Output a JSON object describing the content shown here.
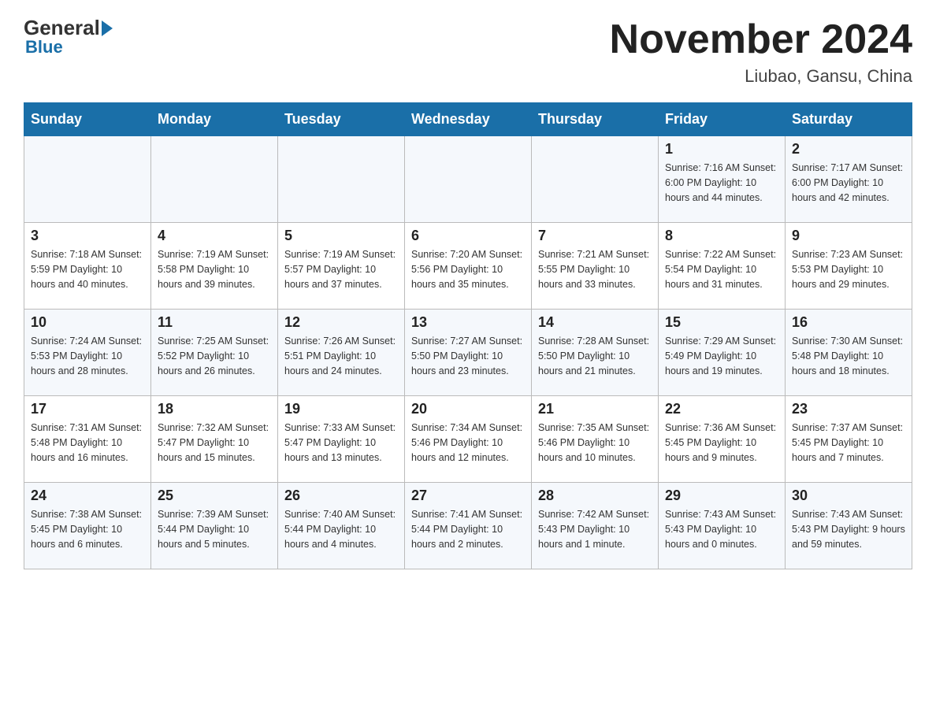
{
  "header": {
    "logo_general": "General",
    "logo_blue": "Blue",
    "month_title": "November 2024",
    "location": "Liubao, Gansu, China"
  },
  "days_of_week": [
    "Sunday",
    "Monday",
    "Tuesday",
    "Wednesday",
    "Thursday",
    "Friday",
    "Saturday"
  ],
  "weeks": [
    [
      {
        "day": "",
        "info": ""
      },
      {
        "day": "",
        "info": ""
      },
      {
        "day": "",
        "info": ""
      },
      {
        "day": "",
        "info": ""
      },
      {
        "day": "",
        "info": ""
      },
      {
        "day": "1",
        "info": "Sunrise: 7:16 AM\nSunset: 6:00 PM\nDaylight: 10 hours and 44 minutes."
      },
      {
        "day": "2",
        "info": "Sunrise: 7:17 AM\nSunset: 6:00 PM\nDaylight: 10 hours and 42 minutes."
      }
    ],
    [
      {
        "day": "3",
        "info": "Sunrise: 7:18 AM\nSunset: 5:59 PM\nDaylight: 10 hours and 40 minutes."
      },
      {
        "day": "4",
        "info": "Sunrise: 7:19 AM\nSunset: 5:58 PM\nDaylight: 10 hours and 39 minutes."
      },
      {
        "day": "5",
        "info": "Sunrise: 7:19 AM\nSunset: 5:57 PM\nDaylight: 10 hours and 37 minutes."
      },
      {
        "day": "6",
        "info": "Sunrise: 7:20 AM\nSunset: 5:56 PM\nDaylight: 10 hours and 35 minutes."
      },
      {
        "day": "7",
        "info": "Sunrise: 7:21 AM\nSunset: 5:55 PM\nDaylight: 10 hours and 33 minutes."
      },
      {
        "day": "8",
        "info": "Sunrise: 7:22 AM\nSunset: 5:54 PM\nDaylight: 10 hours and 31 minutes."
      },
      {
        "day": "9",
        "info": "Sunrise: 7:23 AM\nSunset: 5:53 PM\nDaylight: 10 hours and 29 minutes."
      }
    ],
    [
      {
        "day": "10",
        "info": "Sunrise: 7:24 AM\nSunset: 5:53 PM\nDaylight: 10 hours and 28 minutes."
      },
      {
        "day": "11",
        "info": "Sunrise: 7:25 AM\nSunset: 5:52 PM\nDaylight: 10 hours and 26 minutes."
      },
      {
        "day": "12",
        "info": "Sunrise: 7:26 AM\nSunset: 5:51 PM\nDaylight: 10 hours and 24 minutes."
      },
      {
        "day": "13",
        "info": "Sunrise: 7:27 AM\nSunset: 5:50 PM\nDaylight: 10 hours and 23 minutes."
      },
      {
        "day": "14",
        "info": "Sunrise: 7:28 AM\nSunset: 5:50 PM\nDaylight: 10 hours and 21 minutes."
      },
      {
        "day": "15",
        "info": "Sunrise: 7:29 AM\nSunset: 5:49 PM\nDaylight: 10 hours and 19 minutes."
      },
      {
        "day": "16",
        "info": "Sunrise: 7:30 AM\nSunset: 5:48 PM\nDaylight: 10 hours and 18 minutes."
      }
    ],
    [
      {
        "day": "17",
        "info": "Sunrise: 7:31 AM\nSunset: 5:48 PM\nDaylight: 10 hours and 16 minutes."
      },
      {
        "day": "18",
        "info": "Sunrise: 7:32 AM\nSunset: 5:47 PM\nDaylight: 10 hours and 15 minutes."
      },
      {
        "day": "19",
        "info": "Sunrise: 7:33 AM\nSunset: 5:47 PM\nDaylight: 10 hours and 13 minutes."
      },
      {
        "day": "20",
        "info": "Sunrise: 7:34 AM\nSunset: 5:46 PM\nDaylight: 10 hours and 12 minutes."
      },
      {
        "day": "21",
        "info": "Sunrise: 7:35 AM\nSunset: 5:46 PM\nDaylight: 10 hours and 10 minutes."
      },
      {
        "day": "22",
        "info": "Sunrise: 7:36 AM\nSunset: 5:45 PM\nDaylight: 10 hours and 9 minutes."
      },
      {
        "day": "23",
        "info": "Sunrise: 7:37 AM\nSunset: 5:45 PM\nDaylight: 10 hours and 7 minutes."
      }
    ],
    [
      {
        "day": "24",
        "info": "Sunrise: 7:38 AM\nSunset: 5:45 PM\nDaylight: 10 hours and 6 minutes."
      },
      {
        "day": "25",
        "info": "Sunrise: 7:39 AM\nSunset: 5:44 PM\nDaylight: 10 hours and 5 minutes."
      },
      {
        "day": "26",
        "info": "Sunrise: 7:40 AM\nSunset: 5:44 PM\nDaylight: 10 hours and 4 minutes."
      },
      {
        "day": "27",
        "info": "Sunrise: 7:41 AM\nSunset: 5:44 PM\nDaylight: 10 hours and 2 minutes."
      },
      {
        "day": "28",
        "info": "Sunrise: 7:42 AM\nSunset: 5:43 PM\nDaylight: 10 hours and 1 minute."
      },
      {
        "day": "29",
        "info": "Sunrise: 7:43 AM\nSunset: 5:43 PM\nDaylight: 10 hours and 0 minutes."
      },
      {
        "day": "30",
        "info": "Sunrise: 7:43 AM\nSunset: 5:43 PM\nDaylight: 9 hours and 59 minutes."
      }
    ]
  ]
}
